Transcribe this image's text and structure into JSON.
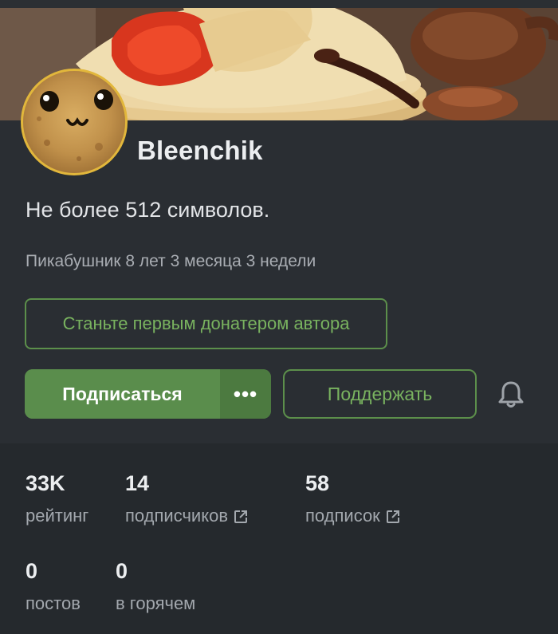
{
  "profile": {
    "username": "Bleenchik",
    "about": "Не более 512 символов.",
    "member_since": "Пикабушник 8 лет 3 месяца 3 недели"
  },
  "actions": {
    "donate_label": "Станьте первым донатером автора",
    "subscribe_label": "Подписаться",
    "more_label": "•••",
    "support_label": "Поддержать"
  },
  "stats": [
    {
      "value": "33K",
      "label": "рейтинг"
    },
    {
      "value": "14",
      "label": "подписчиков"
    },
    {
      "value": "58",
      "label": "подписок"
    },
    {
      "value": "0",
      "label": "постов"
    },
    {
      "value": "0",
      "label": "в горячем"
    }
  ],
  "icons": {
    "bell": "bell-icon",
    "external": "external-link-icon"
  },
  "colors": {
    "accent_green": "#5a8d4c",
    "accent_text_green": "#79b35f",
    "avatar_border": "#e2b73b",
    "background": "#25292d"
  }
}
